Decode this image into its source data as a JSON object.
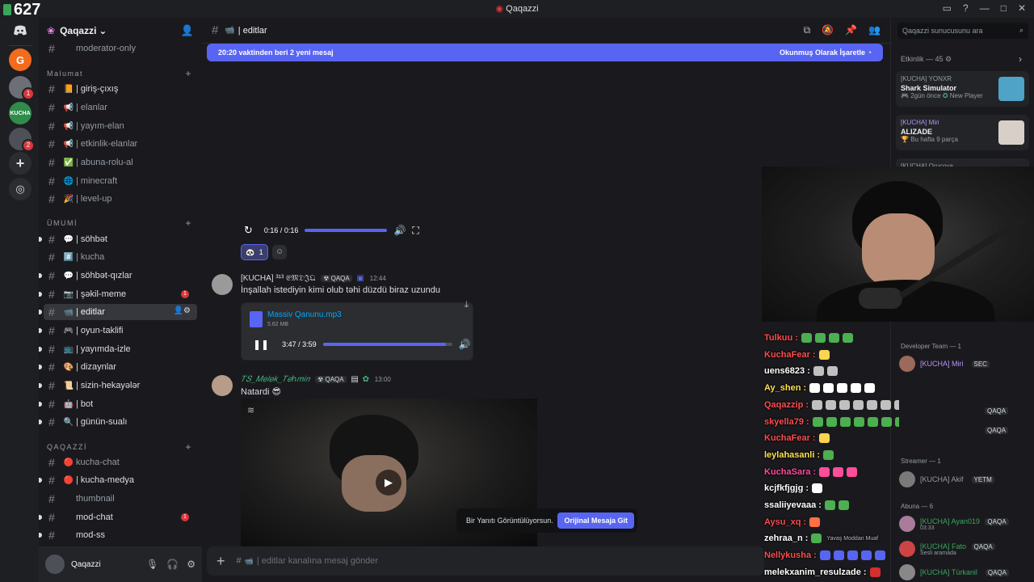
{
  "overlay": {
    "viewer_count": "627"
  },
  "window": {
    "title": "Qaqazzi"
  },
  "server": {
    "name": "Qaqazzi",
    "categories": [
      {
        "label": "Malumat"
      },
      {
        "label": "ÜMUMİ"
      },
      {
        "label": "QAQAZZİ"
      }
    ],
    "channels": [
      {
        "label": "moderator-only",
        "emoji": ""
      },
      {
        "label": "| giriş-çıxış",
        "emoji": "📙"
      },
      {
        "label": "| elanlar",
        "emoji": "📢"
      },
      {
        "label": "| yayım-elan",
        "emoji": "📢"
      },
      {
        "label": "| etkinlik-elanlar",
        "emoji": "📢"
      },
      {
        "label": "| abuna-rolu-al",
        "emoji": "✅"
      },
      {
        "label": "| minecraft",
        "emoji": "🌐"
      },
      {
        "label": "| level-up",
        "emoji": "🎉"
      },
      {
        "label": "| söhbət",
        "emoji": "💬"
      },
      {
        "label": "| kucha",
        "emoji": "#️⃣"
      },
      {
        "label": "| söhbət-qızlar",
        "emoji": "💬"
      },
      {
        "label": "| şəkil-meme",
        "emoji": "📷",
        "badge": "1"
      },
      {
        "label": "| editlar",
        "emoji": "📹"
      },
      {
        "label": "| oyun-taklifi",
        "emoji": "🎮"
      },
      {
        "label": "| yayımda-izle",
        "emoji": "📺"
      },
      {
        "label": "| dizaynlar",
        "emoji": "🎨"
      },
      {
        "label": "| sizin-hekayələr",
        "emoji": "📜"
      },
      {
        "label": "| bot",
        "emoji": "🤖"
      },
      {
        "label": "| günün-sualı",
        "emoji": "🔍"
      },
      {
        "label": "kucha-chat",
        "emoji": "🔴"
      },
      {
        "label": "| kucha-medya",
        "emoji": "🔴"
      },
      {
        "label": "thumbnail",
        "emoji": ""
      },
      {
        "label": "mod-chat",
        "emoji": "",
        "badge": "1"
      },
      {
        "label": "mod-ss",
        "emoji": ""
      }
    ]
  },
  "user": {
    "name": "Qaqazzi"
  },
  "channel": {
    "name": "| editlar"
  },
  "banner": {
    "text": "20:20 vaktinden beri 2 yeni mesaj",
    "action": "Okunmuş Olarak İşaretle"
  },
  "video1": {
    "time": "0:16 / 0:16"
  },
  "reaction": {
    "count": "1"
  },
  "message1": {
    "author": "[KUCHA] ³¹³ 𝔈𝔐𝔇𝔍𝔔",
    "tag": "QAQA",
    "time": "12:44",
    "text": "İnşallah istediyin kimi olub təhi düzdü biraz uzundu",
    "file_name": "Massiv Qanunu.mp3",
    "file_size": "5.62 MB",
    "audio_time": "3:47 / 3:59"
  },
  "message2": {
    "author": "𝑇𝑆_𝑀𝑒𝑙𝑒𝑘_𝑇𝑒ℎ𝑚𝑖𝑛",
    "tag": "QAQA",
    "time": "13:00",
    "text": "Natardi 😎"
  },
  "toast": {
    "text": "Bir Yanıtı Görüntülüyorsun.",
    "button": "Orijinal Mesaja Git"
  },
  "composer": {
    "placeholder": "| editlar kanalına mesaj gönder"
  },
  "right": {
    "search_placeholder": "Qaqazzi sunucusunu ara",
    "activity_header": "Etkinlik — 45",
    "cards": [
      {
        "user": "[KUCHA] YONXR",
        "title": "Shark Simulator",
        "sub": "2gün önce",
        "sub2": "New Player"
      },
      {
        "user": "[KUCHA] Miri",
        "title": "ALIZADE",
        "sub": "Bu hafta 9 parça"
      },
      {
        "user": "[KUCHA] Orucova",
        "title": "",
        "sub": ""
      }
    ],
    "groups": [
      {
        "label": "Developer Team — 1",
        "members": [
          {
            "name": "[KUCHA] Miri",
            "tag": "SEC"
          }
        ]
      },
      {
        "label": "Streamer — 1",
        "members": [
          {
            "name": "[KUCHA] Akif",
            "tag": "YETM"
          }
        ]
      },
      {
        "label": "Abuna — 6",
        "members": [
          {
            "name": "[KUCHA] Ayan019",
            "tag": "QAQA",
            "sub": "03:33"
          },
          {
            "name": "[KUCHA] Fato",
            "tag": "QAQA",
            "sub": "Sesli aramada"
          },
          {
            "name": "[KUCHA] Türkanil",
            "tag": "QAQA"
          }
        ]
      }
    ],
    "extra_tags": [
      "QAQA",
      "QAQA"
    ]
  },
  "stream_chat": [
    {
      "user": "Tulkuu :",
      "color": "#ff4d4d"
    },
    {
      "user": "KuchaFear :",
      "color": "#ff4d4d"
    },
    {
      "user": "uens6823 :",
      "color": "#ffffff"
    },
    {
      "user": "Ay_shen :",
      "color": "#ffe14d"
    },
    {
      "user": "Qaqazzip :",
      "color": "#ff4d4d"
    },
    {
      "user": "skyella79 :",
      "color": "#ff4d4d"
    },
    {
      "user": "KuchaFear :",
      "color": "#ff4d4d"
    },
    {
      "user": "leylahasanli :",
      "color": "#ffe14d"
    },
    {
      "user": "KuchaSara :",
      "color": "#ff4d9a"
    },
    {
      "user": "kcjfkfjgjg :",
      "color": "#ffffff"
    },
    {
      "user": "ssaliiyevaaa :",
      "color": "#ffffff"
    },
    {
      "user": "Aysu_xq :",
      "color": "#ff4d4d"
    },
    {
      "user": "zehraa_n :",
      "color": "#ffffff",
      "note": "Yavaş Moddan Muaf"
    },
    {
      "user": "Nellykusha :",
      "color": "#ff4d4d"
    },
    {
      "user": "melekxanim_resulzade :",
      "color": "#ffffff"
    }
  ],
  "colors": {
    "accent": "#5865f2",
    "danger": "#da373c",
    "bg": "#1a1a1e"
  }
}
